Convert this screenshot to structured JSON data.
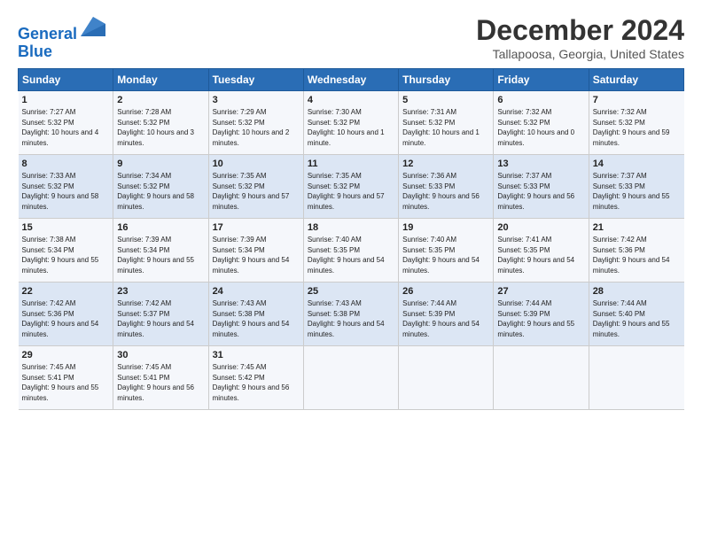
{
  "logo": {
    "line1": "General",
    "line2": "Blue"
  },
  "title": "December 2024",
  "location": "Tallapoosa, Georgia, United States",
  "days_of_week": [
    "Sunday",
    "Monday",
    "Tuesday",
    "Wednesday",
    "Thursday",
    "Friday",
    "Saturday"
  ],
  "weeks": [
    [
      {
        "day": "1",
        "sunrise": "7:27 AM",
        "sunset": "5:32 PM",
        "daylight": "10 hours and 4 minutes."
      },
      {
        "day": "2",
        "sunrise": "7:28 AM",
        "sunset": "5:32 PM",
        "daylight": "10 hours and 3 minutes."
      },
      {
        "day": "3",
        "sunrise": "7:29 AM",
        "sunset": "5:32 PM",
        "daylight": "10 hours and 2 minutes."
      },
      {
        "day": "4",
        "sunrise": "7:30 AM",
        "sunset": "5:32 PM",
        "daylight": "10 hours and 1 minute."
      },
      {
        "day": "5",
        "sunrise": "7:31 AM",
        "sunset": "5:32 PM",
        "daylight": "10 hours and 1 minute."
      },
      {
        "day": "6",
        "sunrise": "7:32 AM",
        "sunset": "5:32 PM",
        "daylight": "10 hours and 0 minutes."
      },
      {
        "day": "7",
        "sunrise": "7:32 AM",
        "sunset": "5:32 PM",
        "daylight": "9 hours and 59 minutes."
      }
    ],
    [
      {
        "day": "8",
        "sunrise": "7:33 AM",
        "sunset": "5:32 PM",
        "daylight": "9 hours and 58 minutes."
      },
      {
        "day": "9",
        "sunrise": "7:34 AM",
        "sunset": "5:32 PM",
        "daylight": "9 hours and 58 minutes."
      },
      {
        "day": "10",
        "sunrise": "7:35 AM",
        "sunset": "5:32 PM",
        "daylight": "9 hours and 57 minutes."
      },
      {
        "day": "11",
        "sunrise": "7:35 AM",
        "sunset": "5:32 PM",
        "daylight": "9 hours and 57 minutes."
      },
      {
        "day": "12",
        "sunrise": "7:36 AM",
        "sunset": "5:33 PM",
        "daylight": "9 hours and 56 minutes."
      },
      {
        "day": "13",
        "sunrise": "7:37 AM",
        "sunset": "5:33 PM",
        "daylight": "9 hours and 56 minutes."
      },
      {
        "day": "14",
        "sunrise": "7:37 AM",
        "sunset": "5:33 PM",
        "daylight": "9 hours and 55 minutes."
      }
    ],
    [
      {
        "day": "15",
        "sunrise": "7:38 AM",
        "sunset": "5:34 PM",
        "daylight": "9 hours and 55 minutes."
      },
      {
        "day": "16",
        "sunrise": "7:39 AM",
        "sunset": "5:34 PM",
        "daylight": "9 hours and 55 minutes."
      },
      {
        "day": "17",
        "sunrise": "7:39 AM",
        "sunset": "5:34 PM",
        "daylight": "9 hours and 54 minutes."
      },
      {
        "day": "18",
        "sunrise": "7:40 AM",
        "sunset": "5:35 PM",
        "daylight": "9 hours and 54 minutes."
      },
      {
        "day": "19",
        "sunrise": "7:40 AM",
        "sunset": "5:35 PM",
        "daylight": "9 hours and 54 minutes."
      },
      {
        "day": "20",
        "sunrise": "7:41 AM",
        "sunset": "5:35 PM",
        "daylight": "9 hours and 54 minutes."
      },
      {
        "day": "21",
        "sunrise": "7:42 AM",
        "sunset": "5:36 PM",
        "daylight": "9 hours and 54 minutes."
      }
    ],
    [
      {
        "day": "22",
        "sunrise": "7:42 AM",
        "sunset": "5:36 PM",
        "daylight": "9 hours and 54 minutes."
      },
      {
        "day": "23",
        "sunrise": "7:42 AM",
        "sunset": "5:37 PM",
        "daylight": "9 hours and 54 minutes."
      },
      {
        "day": "24",
        "sunrise": "7:43 AM",
        "sunset": "5:38 PM",
        "daylight": "9 hours and 54 minutes."
      },
      {
        "day": "25",
        "sunrise": "7:43 AM",
        "sunset": "5:38 PM",
        "daylight": "9 hours and 54 minutes."
      },
      {
        "day": "26",
        "sunrise": "7:44 AM",
        "sunset": "5:39 PM",
        "daylight": "9 hours and 54 minutes."
      },
      {
        "day": "27",
        "sunrise": "7:44 AM",
        "sunset": "5:39 PM",
        "daylight": "9 hours and 55 minutes."
      },
      {
        "day": "28",
        "sunrise": "7:44 AM",
        "sunset": "5:40 PM",
        "daylight": "9 hours and 55 minutes."
      }
    ],
    [
      {
        "day": "29",
        "sunrise": "7:45 AM",
        "sunset": "5:41 PM",
        "daylight": "9 hours and 55 minutes."
      },
      {
        "day": "30",
        "sunrise": "7:45 AM",
        "sunset": "5:41 PM",
        "daylight": "9 hours and 56 minutes."
      },
      {
        "day": "31",
        "sunrise": "7:45 AM",
        "sunset": "5:42 PM",
        "daylight": "9 hours and 56 minutes."
      },
      {
        "day": "",
        "sunrise": "",
        "sunset": "",
        "daylight": ""
      },
      {
        "day": "",
        "sunrise": "",
        "sunset": "",
        "daylight": ""
      },
      {
        "day": "",
        "sunrise": "",
        "sunset": "",
        "daylight": ""
      },
      {
        "day": "",
        "sunrise": "",
        "sunset": "",
        "daylight": ""
      }
    ]
  ],
  "labels": {
    "sunrise": "Sunrise:",
    "sunset": "Sunset:",
    "daylight": "Daylight:"
  }
}
